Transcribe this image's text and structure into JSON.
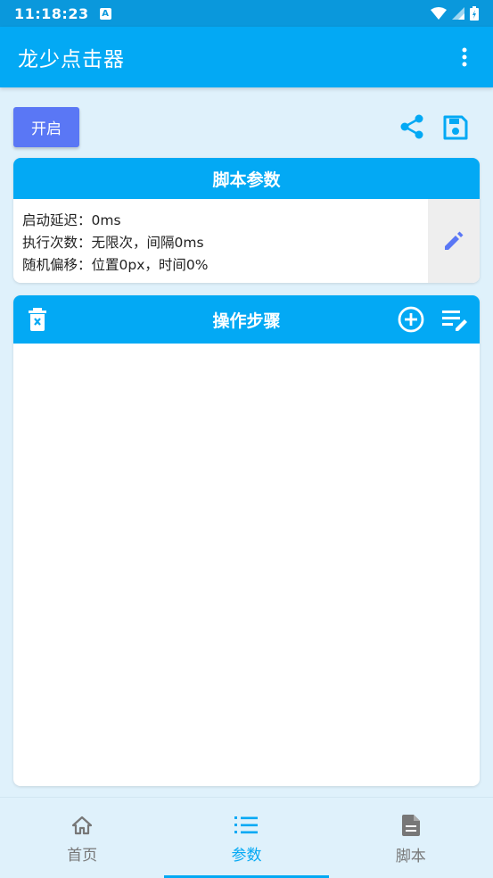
{
  "status_bar": {
    "time": "11:18:23",
    "notification_letter": "A"
  },
  "app_bar": {
    "title": "龙少点击器"
  },
  "controls": {
    "start_label": "开启"
  },
  "script_params": {
    "title": "脚本参数",
    "lines": [
      "启动延迟：0ms",
      "执行次数：无限次，间隔0ms",
      "随机偏移：位置0px，时间0%"
    ]
  },
  "steps": {
    "title": "操作步骤"
  },
  "bottom_nav": {
    "items": [
      {
        "label": "首页",
        "icon": "home-icon",
        "active": false
      },
      {
        "label": "参数",
        "icon": "list-numbered-icon",
        "active": true
      },
      {
        "label": "脚本",
        "icon": "document-icon",
        "active": false
      }
    ]
  },
  "colors": {
    "status_bar": "#0a98dc",
    "primary": "#03a9f4",
    "start_button": "#5a77f5",
    "background": "#dff1fb",
    "edit_icon": "#5a77f5"
  }
}
